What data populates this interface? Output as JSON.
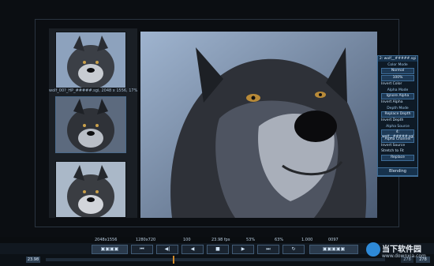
{
  "thumbnails": {
    "caption": "wolf_00?_HP_#####.sgi, 2048 x 1556, 17%",
    "items": [
      "wolf-thumbnail-1",
      "wolf-thumbnail-2",
      "wolf-thumbnail-3"
    ]
  },
  "panel": {
    "title": "2: wolf__#####.sgi",
    "color_mode_label": "Color Mode",
    "color_mode_value": "Normal",
    "opacity_value": "100%",
    "invert_color": "Invert Color",
    "alpha_mode_label": "Alpha Mode",
    "alpha_mode_value": "Ignore Alpha",
    "invert_alpha": "Invert Alpha",
    "depth_mode_label": "Depth Mode",
    "depth_mode_value": "Replace Depth",
    "invert_depth": "Invert Depth",
    "alpha_source_label": "Alpha Source",
    "alpha_source_value": "4: wolf__#####.sgi",
    "alpha_channel": "Alpha Channel",
    "invert_source": "Invert Source",
    "stretch_to_fit": "Stretch to Fit",
    "replace_value": "Replace",
    "blending": "Blending"
  },
  "status": {
    "resolution_source": "2048x1556",
    "resolution_display": "1280x720",
    "zoom": "100",
    "fps": "23.98 fps",
    "percent_a": "53%",
    "percent_b": "63%",
    "gamma": "1.000",
    "frame": "0097"
  },
  "timeline": {
    "start": "23.98",
    "end_a": "278",
    "end_b": "278"
  },
  "watermark": {
    "title": "当下软件园",
    "url": "www.downxia.com"
  },
  "colors": {
    "accent": "#3d6c96",
    "playhead": "#d28b2a"
  }
}
